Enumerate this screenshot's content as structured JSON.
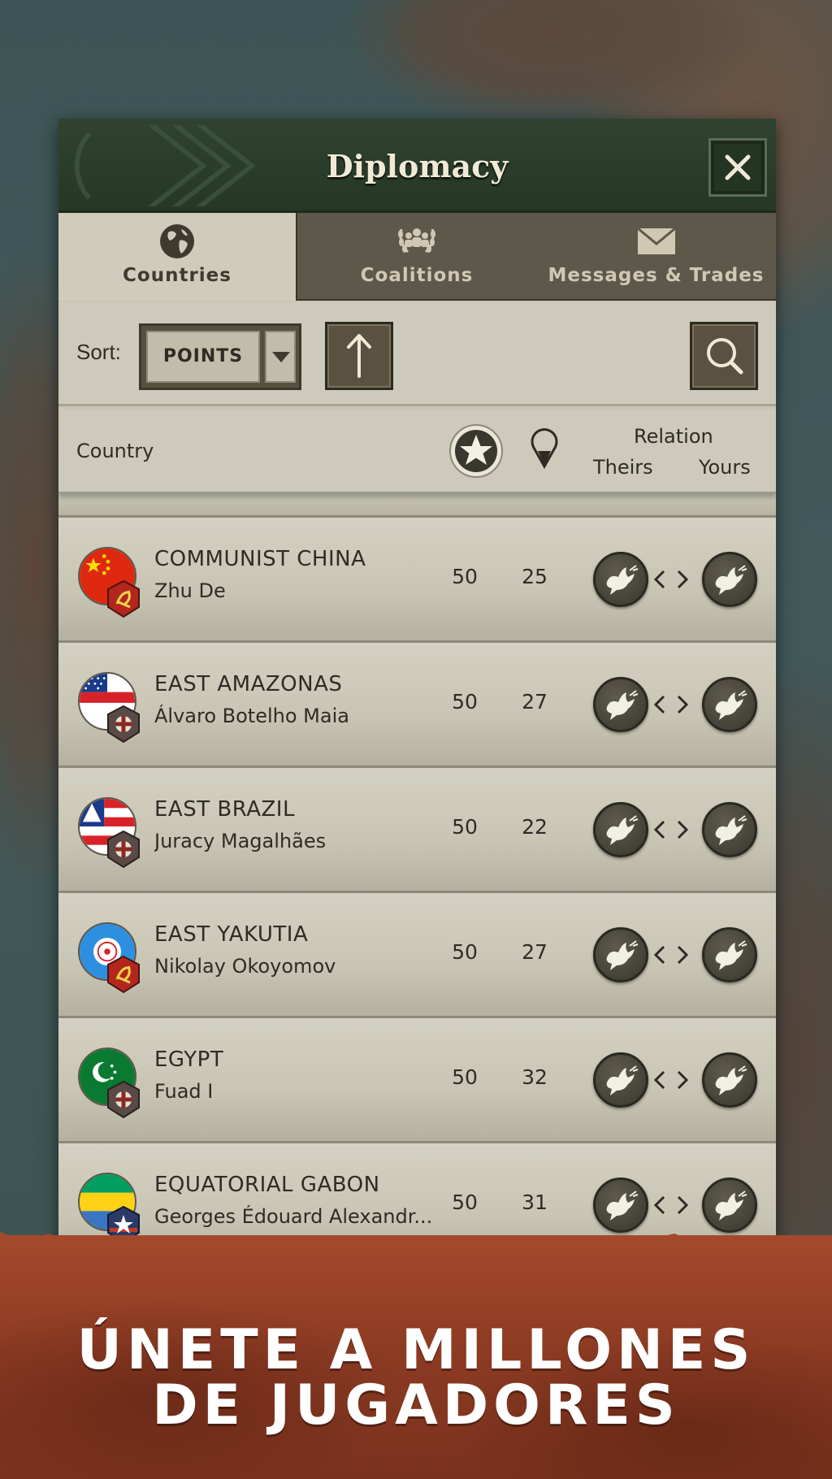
{
  "dialog": {
    "title": "Diplomacy",
    "close_icon": "close-icon"
  },
  "tabs": [
    {
      "label": "Countries",
      "icon": "globe-icon",
      "active": true
    },
    {
      "label": "Coalitions",
      "icon": "coalition-laurel-icon",
      "active": false
    },
    {
      "label": "Messages & Trades",
      "icon": "envelope-icon",
      "active": false
    }
  ],
  "sort": {
    "label": "Sort:",
    "value": "POINTS",
    "direction_icon": "arrow-up-icon",
    "search_icon": "search-icon"
  },
  "columns": {
    "country": "Country",
    "points_icon": "star-icon",
    "provinces_icon": "map-pin-icon",
    "relation": "Relation",
    "theirs": "Theirs",
    "yours": "Yours"
  },
  "rows": [
    {
      "country": "COMMUNIST CHINA",
      "leader": "Zhu De",
      "points": "50",
      "provinces": "25",
      "flag": "china-flag",
      "badge": "communist-badge"
    },
    {
      "country": "EAST AMAZONAS",
      "leader": "Álvaro Botelho Maia",
      "points": "50",
      "provinces": "27",
      "flag": "amazonas-flag",
      "badge": "fascist-badge"
    },
    {
      "country": "EAST BRAZIL",
      "leader": "Juracy Magalhães",
      "points": "50",
      "provinces": "22",
      "flag": "bahia-flag",
      "badge": "fascist-badge"
    },
    {
      "country": "EAST YAKUTIA",
      "leader": "Nikolay Okoyomov",
      "points": "50",
      "provinces": "27",
      "flag": "yakutia-flag",
      "badge": "communist-badge"
    },
    {
      "country": "EGYPT",
      "leader": "Fuad I",
      "points": "50",
      "provinces": "32",
      "flag": "egypt-flag",
      "badge": "fascist-badge"
    },
    {
      "country": "EQUATORIAL GABON",
      "leader": "Georges Édouard Alexandr...",
      "points": "50",
      "provinces": "31",
      "flag": "gabon-flag",
      "badge": "allied-badge"
    }
  ],
  "relation_icon": "peace-dove-icon",
  "banner": {
    "line1": "ÚNETE A MILLONES",
    "line2": "DE JUGADORES"
  },
  "colors": {
    "header_green": "#2f4330",
    "panel_beige": "#c9c6b5",
    "banner_red": "#a4492c"
  }
}
